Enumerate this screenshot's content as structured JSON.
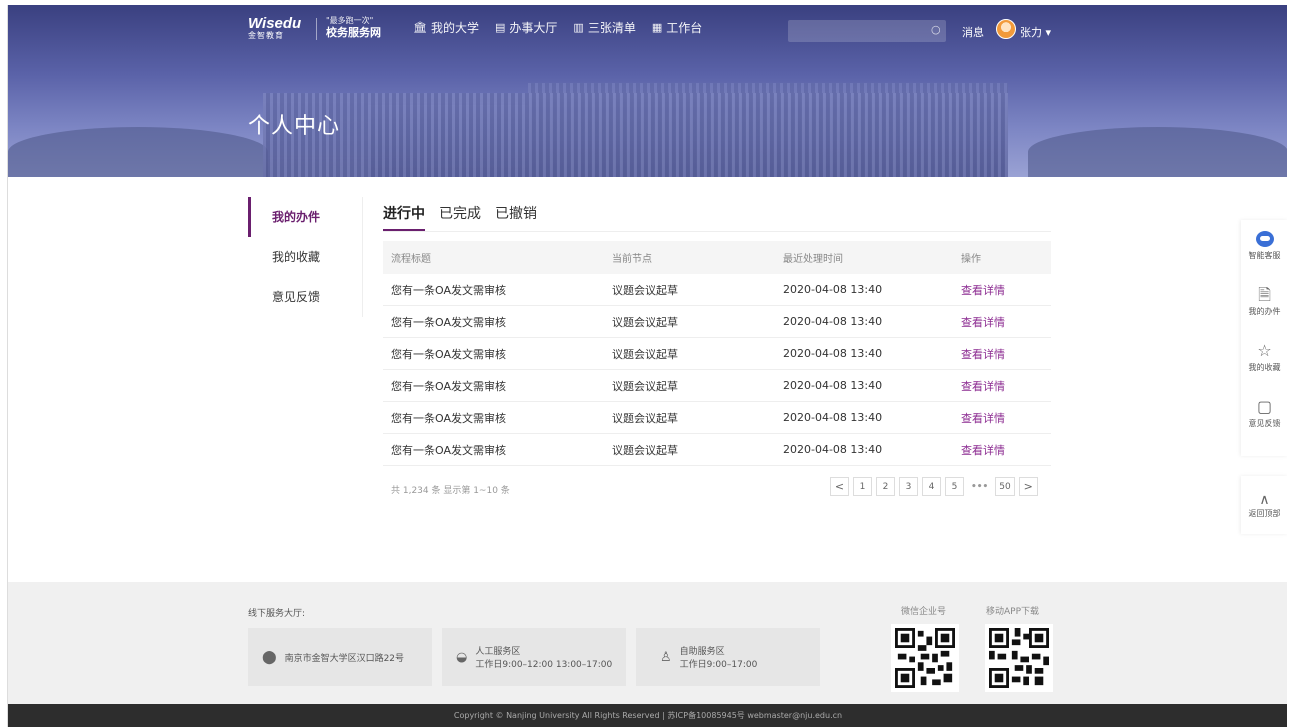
{
  "header": {
    "logo_word": "Wisedu",
    "logo_sub": "金智教育",
    "slogan_top": "\"最多跑一次\"",
    "slogan_main": "校务服务网",
    "nav": [
      {
        "icon": "bank-icon",
        "label": "我的大学"
      },
      {
        "icon": "service-hall-icon",
        "label": "办事大厅"
      },
      {
        "icon": "list-icon",
        "label": "三张清单"
      },
      {
        "icon": "workbench-icon",
        "label": "工作台"
      }
    ],
    "search_placeholder": "",
    "messages_label": "消息",
    "user_name": "张力",
    "page_title": "个人中心"
  },
  "sidebar": {
    "items": [
      {
        "label": "我的办件",
        "active": true
      },
      {
        "label": "我的收藏",
        "active": false
      },
      {
        "label": "意见反馈",
        "active": false
      }
    ]
  },
  "tabs": [
    {
      "label": "进行中",
      "active": true
    },
    {
      "label": "已完成",
      "active": false
    },
    {
      "label": "已撤销",
      "active": false
    }
  ],
  "table": {
    "columns": [
      "流程标题",
      "当前节点",
      "最近处理时间",
      "操作"
    ],
    "rows": [
      [
        "您有一条OA发文需审核",
        "议题会议起草",
        "2020-04-08 13:40",
        "查看详情"
      ],
      [
        "您有一条OA发文需审核",
        "议题会议起草",
        "2020-04-08 13:40",
        "查看详情"
      ],
      [
        "您有一条OA发文需审核",
        "议题会议起草",
        "2020-04-08 13:40",
        "查看详情"
      ],
      [
        "您有一条OA发文需审核",
        "议题会议起草",
        "2020-04-08 13:40",
        "查看详情"
      ],
      [
        "您有一条OA发文需审核",
        "议题会议起草",
        "2020-04-08 13:40",
        "查看详情"
      ],
      [
        "您有一条OA发文需审核",
        "议题会议起草",
        "2020-04-08 13:40",
        "查看详情"
      ]
    ]
  },
  "pagination": {
    "total_text": "共 1,234 条 显示第 1~10 条",
    "prev": "<",
    "pages": [
      "1",
      "2",
      "3",
      "4",
      "5"
    ],
    "ellipsis": "•••",
    "last": "50",
    "next": ">"
  },
  "floatbar": {
    "items": [
      "智能客服",
      "我的办件",
      "我的收藏",
      "意见反馈"
    ],
    "back_to_top": "返回顶部"
  },
  "footer": {
    "title": "线下服务大厅:",
    "address": "南京市金智大学区汉口路22号",
    "manual_area": "人工服务区",
    "manual_hours": "工作日9:00–12:00 13:00–17:00",
    "self_area": "自助服务区",
    "self_hours": "工作日9:00–17:00",
    "qr_wechat_label": "微信企业号",
    "qr_app_label": "移动APP下载",
    "copyright": "Copyright © Nanjing University All Rights Reserved | 苏ICP备10085945号  webmaster@nju.edu.cn"
  },
  "colors": {
    "accent": "#6a1f6e",
    "link": "#8b2a90",
    "header_bg": "#3a4080"
  }
}
